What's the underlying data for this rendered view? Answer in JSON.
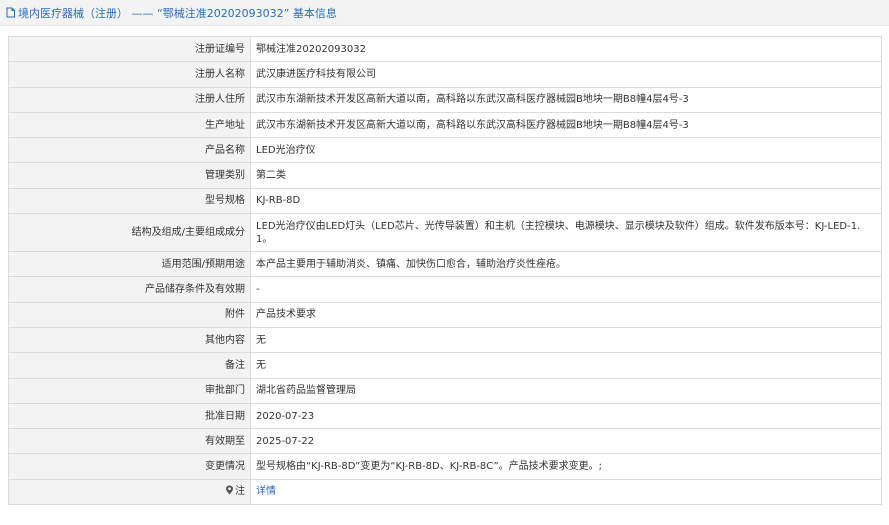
{
  "header": {
    "title": "境内医疗器械（注册） —— “鄂械注准20202093032” 基本信息"
  },
  "rows": [
    {
      "label": "注册证编号",
      "value": "鄂械注准20202093032"
    },
    {
      "label": "注册人名称",
      "value": "武汉康进医疗科技有限公司"
    },
    {
      "label": "注册人住所",
      "value": "武汉市东湖新技术开发区高新大道以南，高科路以东武汉高科医疗器械园B地块一期B8幢4层4号-3"
    },
    {
      "label": "生产地址",
      "value": "武汉市东湖新技术开发区高新大道以南，高科路以东武汉高科医疗器械园B地块一期B8幢4层4号-3"
    },
    {
      "label": "产品名称",
      "value": "LED光治疗仪"
    },
    {
      "label": "管理类别",
      "value": "第二类"
    },
    {
      "label": "型号规格",
      "value": "KJ-RB-8D"
    },
    {
      "label": "结构及组成/主要组成成分",
      "value": "LED光治疗仪由LED灯头（LED芯片、光传导装置）和主机（主控模块、电源模块、显示模块及软件）组成。软件发布版本号：KJ-LED-1.1。"
    },
    {
      "label": "适用范围/预期用途",
      "value": "本产品主要用于辅助消炎、镇痛、加快伤口愈合，辅助治疗炎性痤疮。"
    },
    {
      "label": "产品储存条件及有效期",
      "value": "-"
    },
    {
      "label": "附件",
      "value": "产品技术要求"
    },
    {
      "label": "其他内容",
      "value": "无"
    },
    {
      "label": "备注",
      "value": "无"
    },
    {
      "label": "审批部门",
      "value": "湖北省药品监督管理局"
    },
    {
      "label": "批准日期",
      "value": "2020-07-23"
    },
    {
      "label": "有效期至",
      "value": "2025-07-22"
    },
    {
      "label": "变更情况",
      "value": "型号规格由“KJ-RB-8D”变更为“KJ-RB-8D、KJ-RB-8C”。产品技术要求变更。;"
    }
  ],
  "note_row": {
    "label": "注",
    "link": "详情",
    "icon": "map-pin-icon"
  },
  "colors": {
    "link": "#2a6db8",
    "label_bg": "#f3f3f3",
    "border": "#dcdcdc"
  }
}
